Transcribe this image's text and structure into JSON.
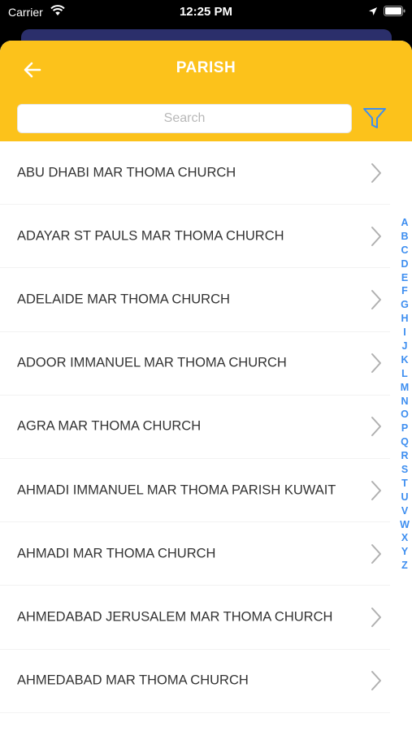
{
  "status_bar": {
    "carrier": "Carrier",
    "time": "12:25 PM"
  },
  "header": {
    "title": "PARISH"
  },
  "search": {
    "placeholder": "Search",
    "value": ""
  },
  "parishes": [
    "ABU DHABI MAR THOMA CHURCH",
    "ADAYAR ST PAULS MAR THOMA CHURCH",
    "ADELAIDE MAR THOMA CHURCH",
    "ADOOR IMMANUEL MAR THOMA CHURCH",
    "AGRA MAR THOMA CHURCH",
    "AHMADI IMMANUEL MAR THOMA PARISH KUWAIT",
    "AHMADI MAR THOMA CHURCH",
    "AHMEDABAD JERUSALEM MAR THOMA CHURCH",
    "AHMEDABAD MAR THOMA CHURCH"
  ],
  "index_letters": [
    "A",
    "B",
    "C",
    "D",
    "E",
    "F",
    "G",
    "H",
    "I",
    "J",
    "K",
    "L",
    "M",
    "N",
    "O",
    "P",
    "Q",
    "R",
    "S",
    "T",
    "U",
    "V",
    "W",
    "X",
    "Y",
    "Z"
  ],
  "colors": {
    "header": "#fcc21b",
    "index": "#3d8ef0",
    "back_card": "#2b2f6b"
  },
  "icons": {
    "back": "arrow-left-icon",
    "filter": "filter-icon",
    "row": "chevron-right-icon"
  }
}
